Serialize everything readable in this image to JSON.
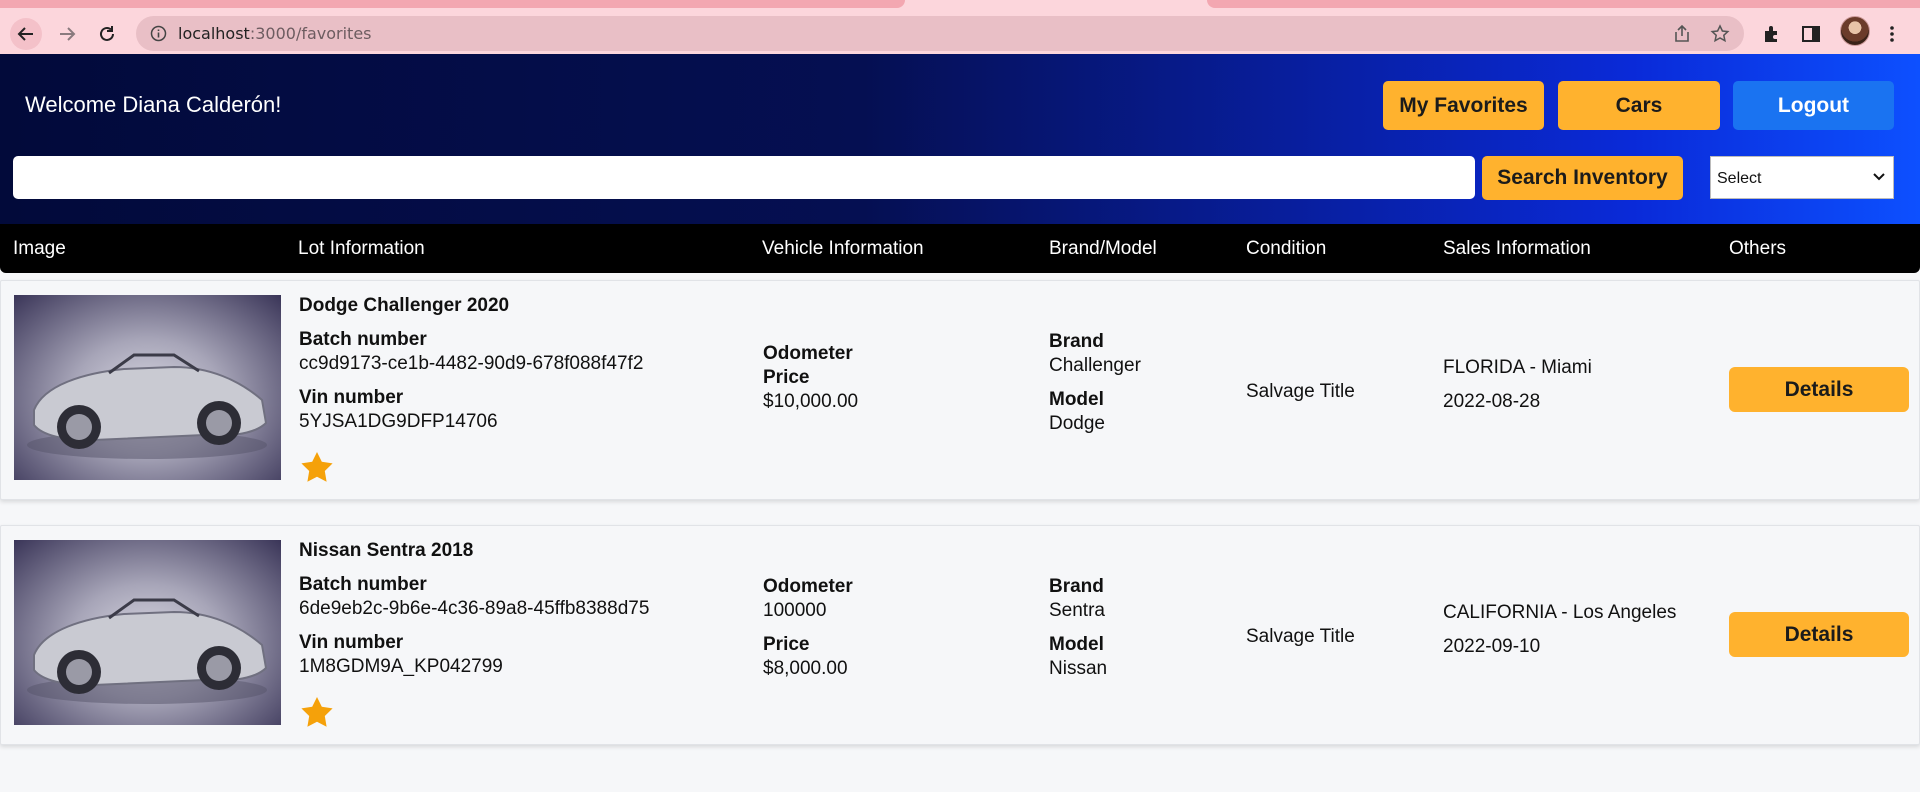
{
  "browser": {
    "url_host": "localhost",
    "url_path": ":3000/favorites"
  },
  "header": {
    "welcome": "Welcome Diana Calderón!",
    "favorites_label": "My Favorites",
    "cars_label": "Cars",
    "logout_label": "Logout",
    "search_value": "",
    "search_button_label": "Search Inventory",
    "select_value": "Select"
  },
  "columns": [
    "Image",
    "Lot Information",
    "Vehicle Information",
    "Brand/Model",
    "Condition",
    "Sales Information",
    "Others"
  ],
  "labels": {
    "batch": "Batch number",
    "vin": "Vin number",
    "odometer": "Odometer",
    "price": "Price",
    "brand": "Brand",
    "model": "Model",
    "details": "Details"
  },
  "rows": [
    {
      "title": "Dodge Challenger 2020",
      "batch_number": "cc9d9173-ce1b-4482-90d9-678f088f47f2",
      "vin_number": "5YJSA1DG9DFP14706",
      "odometer": "",
      "price": "$10,000.00",
      "brand": "Challenger",
      "model": "Dodge",
      "condition": "Salvage Title",
      "location": "FLORIDA - Miami",
      "sale_date": "2022-08-28",
      "favorite": true
    },
    {
      "title": "Nissan Sentra 2018",
      "batch_number": "6de9eb2c-9b6e-4c36-89a8-45ffb8388d75",
      "vin_number": "1M8GDM9A_KP042799",
      "odometer": "100000",
      "price": "$8,000.00",
      "brand": "Sentra",
      "model": "Nissan",
      "condition": "Salvage Title",
      "location": "CALIFORNIA - Los Angeles",
      "sale_date": "2022-09-10",
      "favorite": true
    }
  ],
  "colors": {
    "accent": "#ffb22e",
    "logout": "#1a73f1",
    "star": "#f5a10a"
  }
}
